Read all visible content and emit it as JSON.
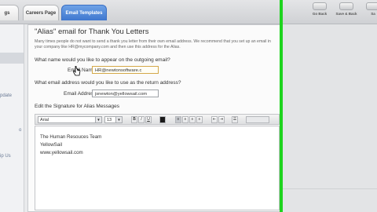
{
  "tabs": [
    {
      "label": "gs",
      "active": false
    },
    {
      "label": "Careers Page",
      "active": false
    },
    {
      "label": "Email Templates",
      "active": true
    }
  ],
  "toolbar_buttons": [
    {
      "label": "Go Back",
      "icon": "back-icon"
    },
    {
      "label": "Save & Back",
      "icon": "save-back-icon"
    },
    {
      "label": "Sa",
      "icon": "save-icon"
    }
  ],
  "sidebar": {
    "items": [
      "pdate",
      "o",
      "ip Us"
    ]
  },
  "panel": {
    "title": "\"Alias\" email for Thank You Letters",
    "intro": "Many times people do not want to send a thank you letter from their own email address. We recommend that you set up an email in your company like HR@mycompany.com and then use this address for the Alias.",
    "q_name": "What name would you like to appear on the outgoing email?",
    "name_label": "Email Name:",
    "name_value": "HR@newtonsoftware.c",
    "q_address": "What email address would you like to use as the return address?",
    "address_label": "Email Address:",
    "address_value": "jsnewton@yellowsail.com",
    "sig_heading": "Edit the Signature for Alias Messages"
  },
  "editor_toolbar": {
    "font": "Arial",
    "size": "13",
    "bold": "B",
    "italic": "I",
    "underline": "U"
  },
  "signature": {
    "lines": [
      "The Human Resouces Team",
      "YellowSail",
      "www.yellowsail.com"
    ]
  },
  "colors": {
    "active_tab": "#3f77cf",
    "field_border": "#d4a94a",
    "green_bar": "#1ed41e"
  }
}
